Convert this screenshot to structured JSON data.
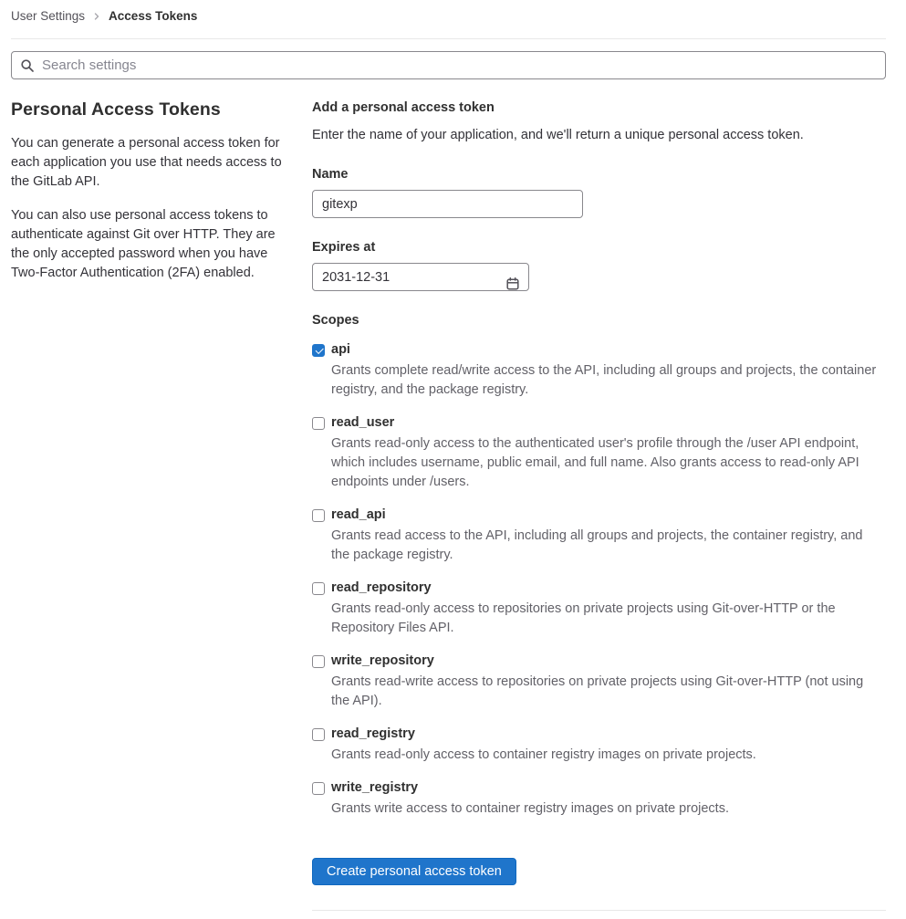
{
  "breadcrumb": {
    "parent": "User Settings",
    "current": "Access Tokens"
  },
  "search": {
    "placeholder": "Search settings"
  },
  "sidebar": {
    "title": "Personal Access Tokens",
    "paragraphs": {
      "p1": "You can generate a personal access token for each application you use that needs access to the GitLab API.",
      "p2": "You can also use personal access tokens to authenticate against Git over HTTP. They are the only accepted password when you have Two-Factor Authentication (2FA) enabled."
    }
  },
  "form": {
    "title": "Add a personal access token",
    "description": "Enter the name of your application, and we'll return a unique personal access token.",
    "name_label": "Name",
    "name_value": "gitexp",
    "expires_label": "Expires at",
    "expires_value": "2031-12-31",
    "scopes_label": "Scopes",
    "scopes": [
      {
        "name": "api",
        "checked": true,
        "description": "Grants complete read/write access to the API, including all groups and projects, the container registry, and the package registry."
      },
      {
        "name": "read_user",
        "checked": false,
        "description": "Grants read-only access to the authenticated user's profile through the /user API endpoint, which includes username, public email, and full name. Also grants access to read-only API endpoints under /users."
      },
      {
        "name": "read_api",
        "checked": false,
        "description": "Grants read access to the API, including all groups and projects, the container registry, and the package registry."
      },
      {
        "name": "read_repository",
        "checked": false,
        "description": "Grants read-only access to repositories on private projects using Git-over-HTTP or the Repository Files API."
      },
      {
        "name": "write_repository",
        "checked": false,
        "description": "Grants read-write access to repositories on private projects using Git-over-HTTP (not using the API)."
      },
      {
        "name": "read_registry",
        "checked": false,
        "description": "Grants read-only access to container registry images on private projects."
      },
      {
        "name": "write_registry",
        "checked": false,
        "description": "Grants write access to container registry images on private projects."
      }
    ],
    "submit_label": "Create personal access token"
  },
  "icons": {
    "search": "search-icon",
    "calendar": "calendar-icon",
    "breadcrumb_chevron": "chevron-right-icon"
  },
  "colors": {
    "accent": "#1f75cb",
    "text_primary": "#303030",
    "text_secondary": "#626168",
    "input_border": "#89888d",
    "divider": "#e8e8e8"
  }
}
